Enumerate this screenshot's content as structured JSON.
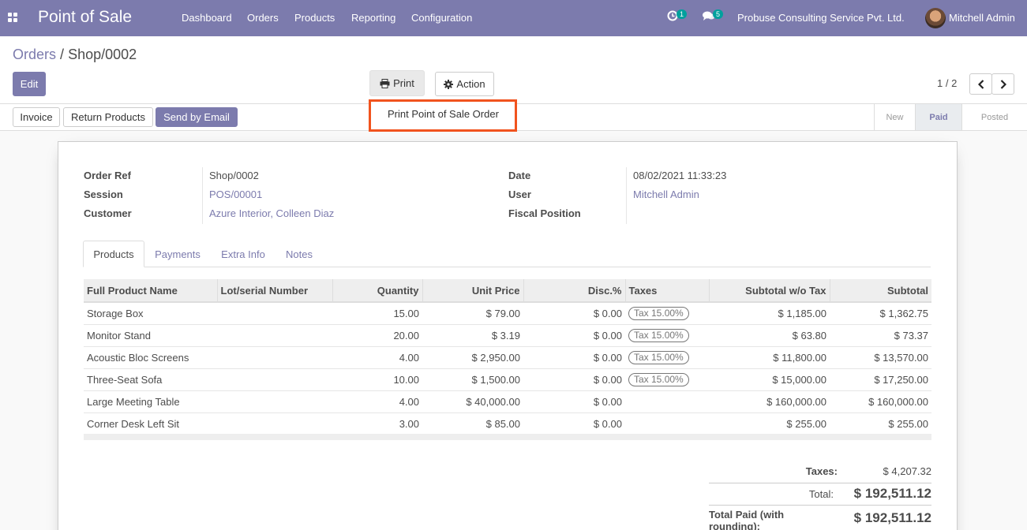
{
  "navbar": {
    "brand": "Point of Sale",
    "menu": [
      "Dashboard",
      "Orders",
      "Products",
      "Reporting",
      "Configuration"
    ],
    "activity_count": "1",
    "message_count": "5",
    "company": "Probuse Consulting Service Pvt. Ltd.",
    "user": "Mitchell Admin"
  },
  "breadcrumb": {
    "parent": "Orders",
    "separator": "/",
    "current": "Shop/0002"
  },
  "buttons": {
    "edit": "Edit",
    "print": "Print",
    "action": "Action"
  },
  "print_menu": {
    "item": "Print Point of Sale Order"
  },
  "pager": {
    "value": "1 / 2"
  },
  "status_buttons": {
    "invoice": "Invoice",
    "return": "Return Products",
    "email": "Send by Email"
  },
  "stages": [
    "New",
    "Paid",
    "Posted"
  ],
  "active_stage": "Paid",
  "form": {
    "order_ref_label": "Order Ref",
    "order_ref": "Shop/0002",
    "session_label": "Session",
    "session": "POS/00001",
    "customer_label": "Customer",
    "customer": "Azure Interior, Colleen Diaz",
    "date_label": "Date",
    "date": "08/02/2021 11:33:23",
    "user_label": "User",
    "user": "Mitchell Admin",
    "fiscal_label": "Fiscal Position",
    "fiscal": ""
  },
  "tabs": [
    "Products",
    "Payments",
    "Extra Info",
    "Notes"
  ],
  "columns": [
    "Full Product Name",
    "Lot/serial Number",
    "Quantity",
    "Unit Price",
    "Disc.%",
    "Taxes",
    "Subtotal w/o Tax",
    "Subtotal"
  ],
  "lines": [
    {
      "name": "Storage Box",
      "lot": "",
      "qty": "15.00",
      "price": "$ 79.00",
      "disc": "$ 0.00",
      "tax": "Tax 15.00%",
      "subtotal_wo": "$ 1,185.00",
      "subtotal": "$ 1,362.75"
    },
    {
      "name": "Monitor Stand",
      "lot": "",
      "qty": "20.00",
      "price": "$ 3.19",
      "disc": "$ 0.00",
      "tax": "Tax 15.00%",
      "subtotal_wo": "$ 63.80",
      "subtotal": "$ 73.37"
    },
    {
      "name": "Acoustic Bloc Screens",
      "lot": "",
      "qty": "4.00",
      "price": "$ 2,950.00",
      "disc": "$ 0.00",
      "tax": "Tax 15.00%",
      "subtotal_wo": "$ 11,800.00",
      "subtotal": "$ 13,570.00"
    },
    {
      "name": "Three-Seat Sofa",
      "lot": "",
      "qty": "10.00",
      "price": "$ 1,500.00",
      "disc": "$ 0.00",
      "tax": "Tax 15.00%",
      "subtotal_wo": "$ 15,000.00",
      "subtotal": "$ 17,250.00"
    },
    {
      "name": "Large Meeting Table",
      "lot": "",
      "qty": "4.00",
      "price": "$ 40,000.00",
      "disc": "$ 0.00",
      "tax": "",
      "subtotal_wo": "$ 160,000.00",
      "subtotal": "$ 160,000.00"
    },
    {
      "name": "Corner Desk Left Sit",
      "lot": "",
      "qty": "3.00",
      "price": "$ 85.00",
      "disc": "$ 0.00",
      "tax": "",
      "subtotal_wo": "$ 255.00",
      "subtotal": "$ 255.00"
    }
  ],
  "totals": {
    "taxes_label": "Taxes:",
    "taxes": "$ 4,207.32",
    "total_label": "Total:",
    "total": "$ 192,511.12",
    "paid_label": "Total Paid (with rounding):",
    "paid": "$ 192,511.12"
  },
  "colors": {
    "brand": "#7c7bad",
    "highlight": "#f1531e",
    "badge": "#00a09d"
  }
}
